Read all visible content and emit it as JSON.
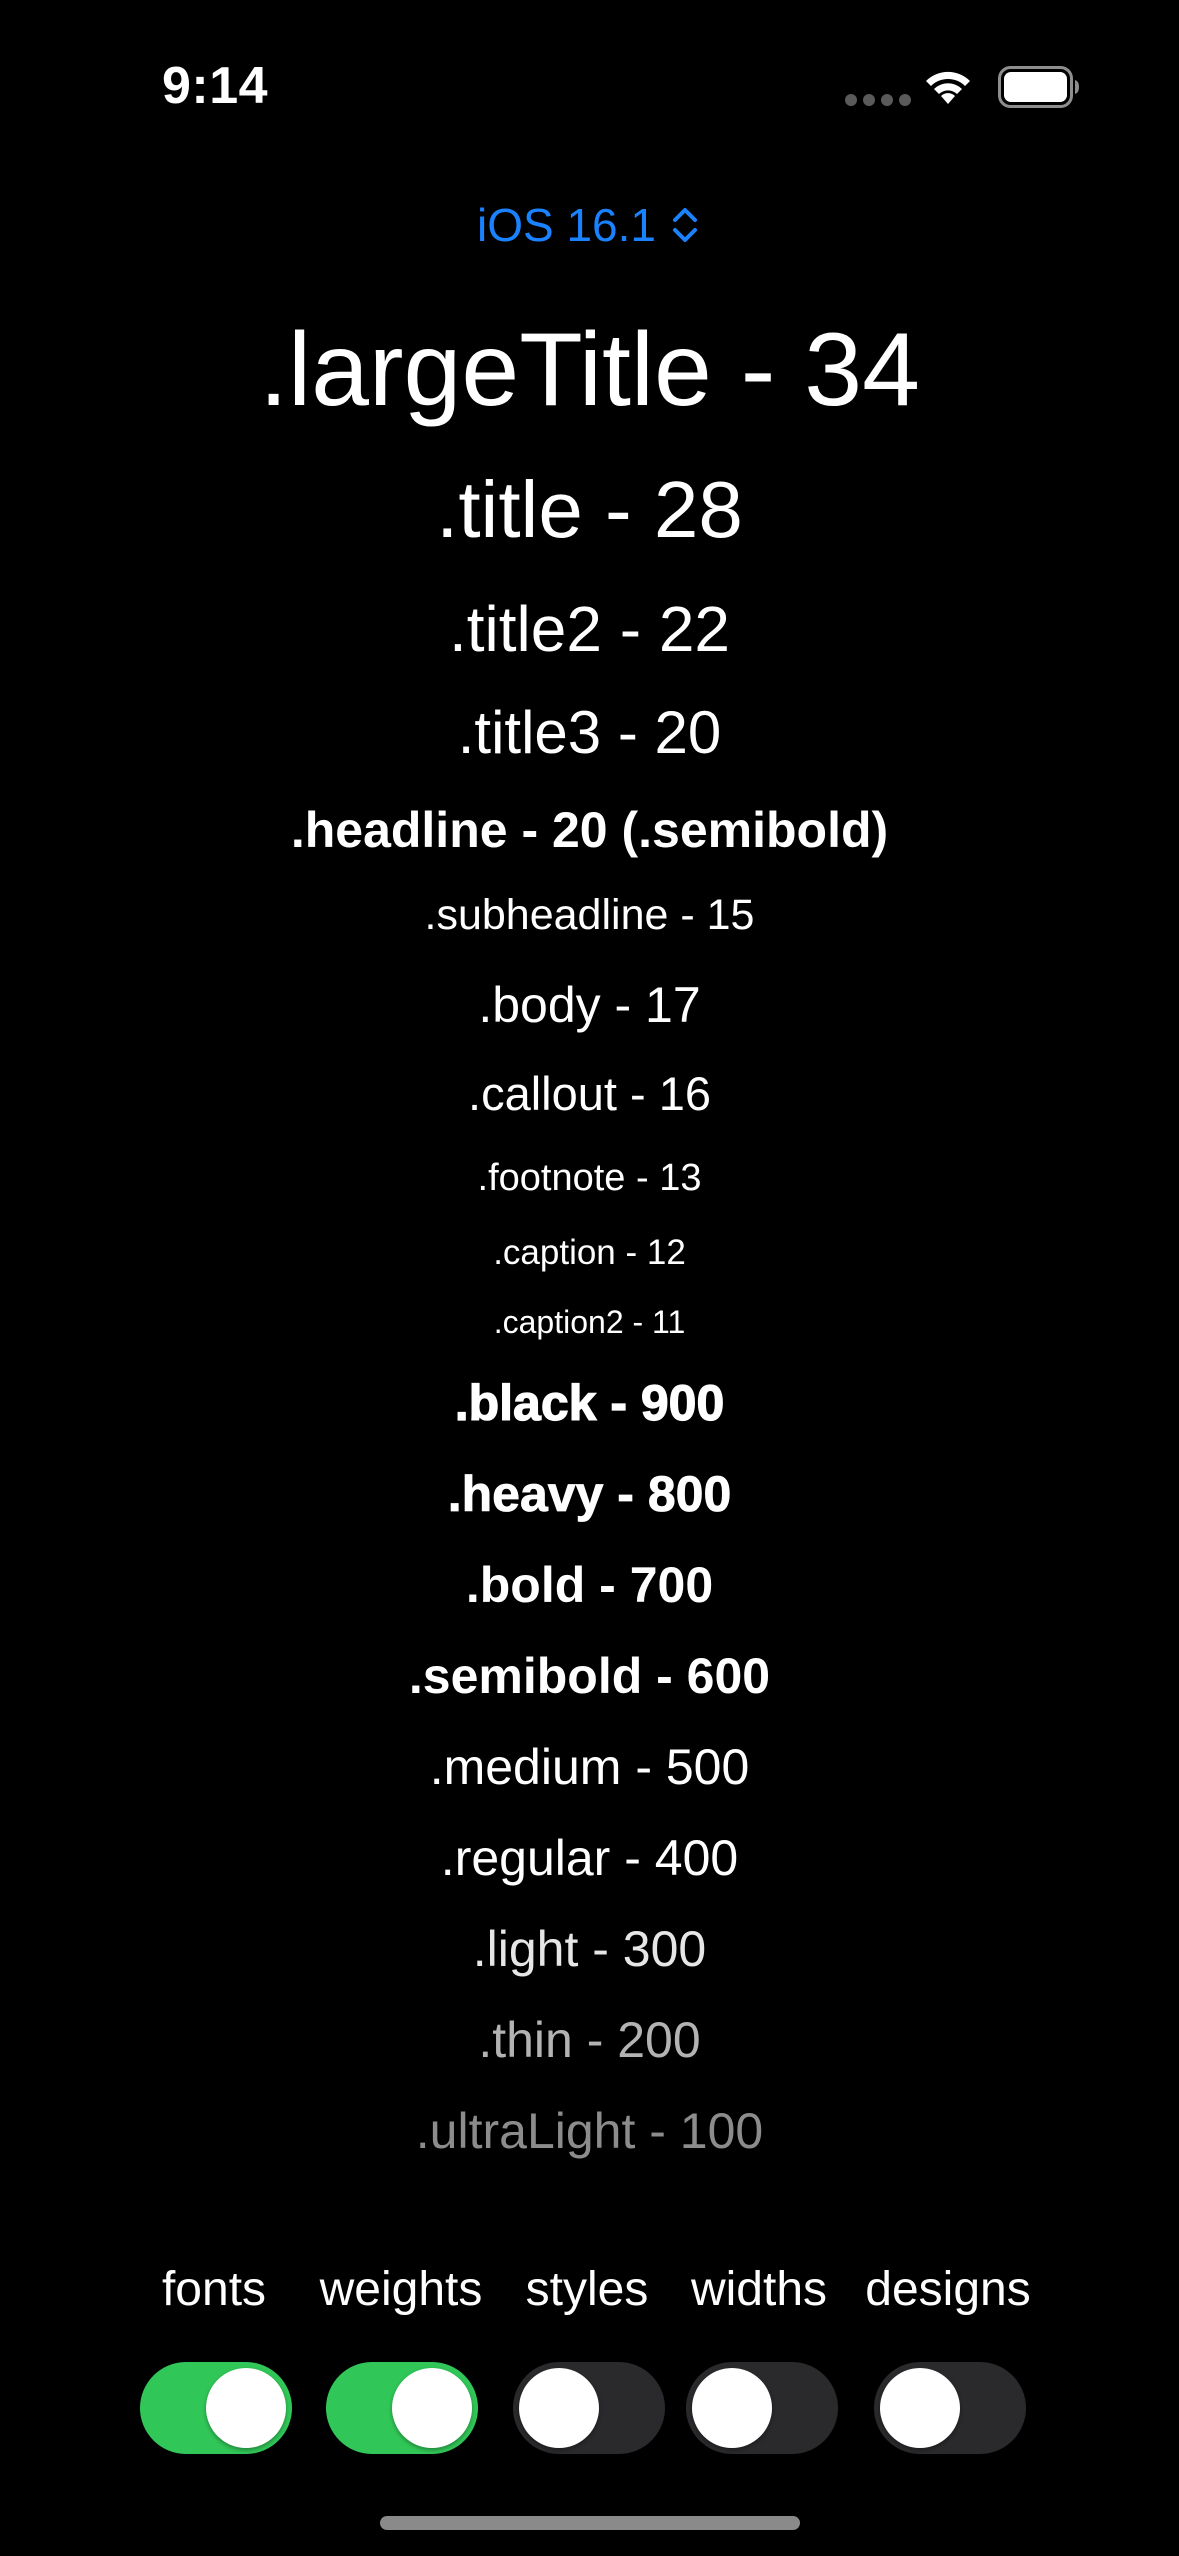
{
  "status_bar": {
    "time": "9:14"
  },
  "version_picker": {
    "label": "iOS 16.1",
    "color": "#1a82ff"
  },
  "text_styles": [
    {
      "label": ".largeTitle - 34",
      "style": "largeTitle"
    },
    {
      "label": ".title - 28",
      "style": "title"
    },
    {
      "label": ".title2 - 22",
      "style": "title2"
    },
    {
      "label": ".title3 - 20",
      "style": "title3"
    },
    {
      "label": ".headline - 20 (.semibold)",
      "style": "headline"
    },
    {
      "label": ".subheadline - 15",
      "style": "subheadline"
    },
    {
      "label": ".body - 17",
      "style": "body"
    },
    {
      "label": ".callout - 16",
      "style": "callout"
    },
    {
      "label": ".footnote - 13",
      "style": "footnote"
    },
    {
      "label": ".caption - 12",
      "style": "caption"
    },
    {
      "label": ".caption2 - 11",
      "style": "caption2"
    }
  ],
  "weights": [
    {
      "label": ".black - 900",
      "weight": "black"
    },
    {
      "label": ".heavy - 800",
      "weight": "heavy"
    },
    {
      "label": ".bold - 700",
      "weight": "bold"
    },
    {
      "label": ".semibold - 600",
      "weight": "semibold"
    },
    {
      "label": ".medium - 500",
      "weight": "medium"
    },
    {
      "label": ".regular - 400",
      "weight": "regular"
    },
    {
      "label": ".light - 300",
      "weight": "light"
    },
    {
      "label": ".thin - 200",
      "weight": "thin"
    },
    {
      "label": ".ultraLight - 100",
      "weight": "ultraLight"
    }
  ],
  "toggles": [
    {
      "label": "fonts",
      "on": true
    },
    {
      "label": "weights",
      "on": true
    },
    {
      "label": "styles",
      "on": false
    },
    {
      "label": "widths",
      "on": false
    },
    {
      "label": "designs",
      "on": false
    }
  ],
  "colors": {
    "background": "#000000",
    "toggle_on": "#31c758",
    "toggle_off": "#2a2a2d",
    "accent": "#1a82ff"
  }
}
